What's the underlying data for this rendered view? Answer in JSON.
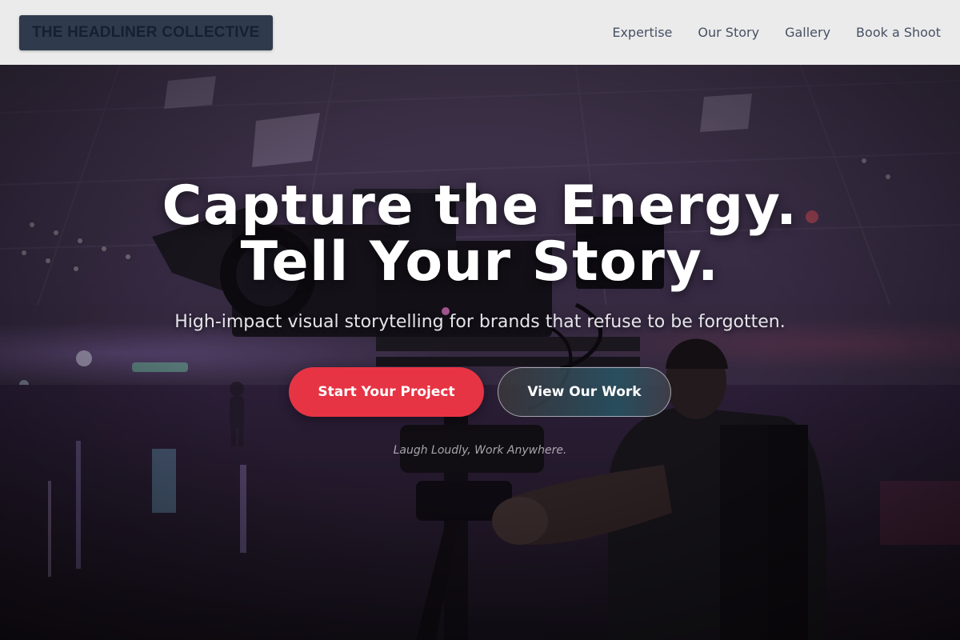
{
  "header": {
    "logo_text": "THE HEADLINER COLLECTIVE",
    "nav": [
      {
        "label": "Expertise"
      },
      {
        "label": "Our Story"
      },
      {
        "label": "Gallery"
      },
      {
        "label": "Book a Shoot"
      }
    ]
  },
  "hero": {
    "headline_line1": "Capture the Energy.",
    "headline_line2": "Tell Your Story.",
    "subheadline": "High-impact visual storytelling for brands that refuse to be forgotten.",
    "primary_cta": "Start Your Project",
    "secondary_cta": "View Our Work",
    "tagline": "Laugh Loudly, Work Anywhere.",
    "background_image": "videographer-with-cinema-camera-in-roller-rink-photo"
  },
  "colors": {
    "header_bg": "#ebebeb",
    "logo_bg": "#2f3a4d",
    "logo_text": "#152033",
    "nav_text": "#465064",
    "primary_button": "#e63444",
    "headline": "#ffffff"
  }
}
